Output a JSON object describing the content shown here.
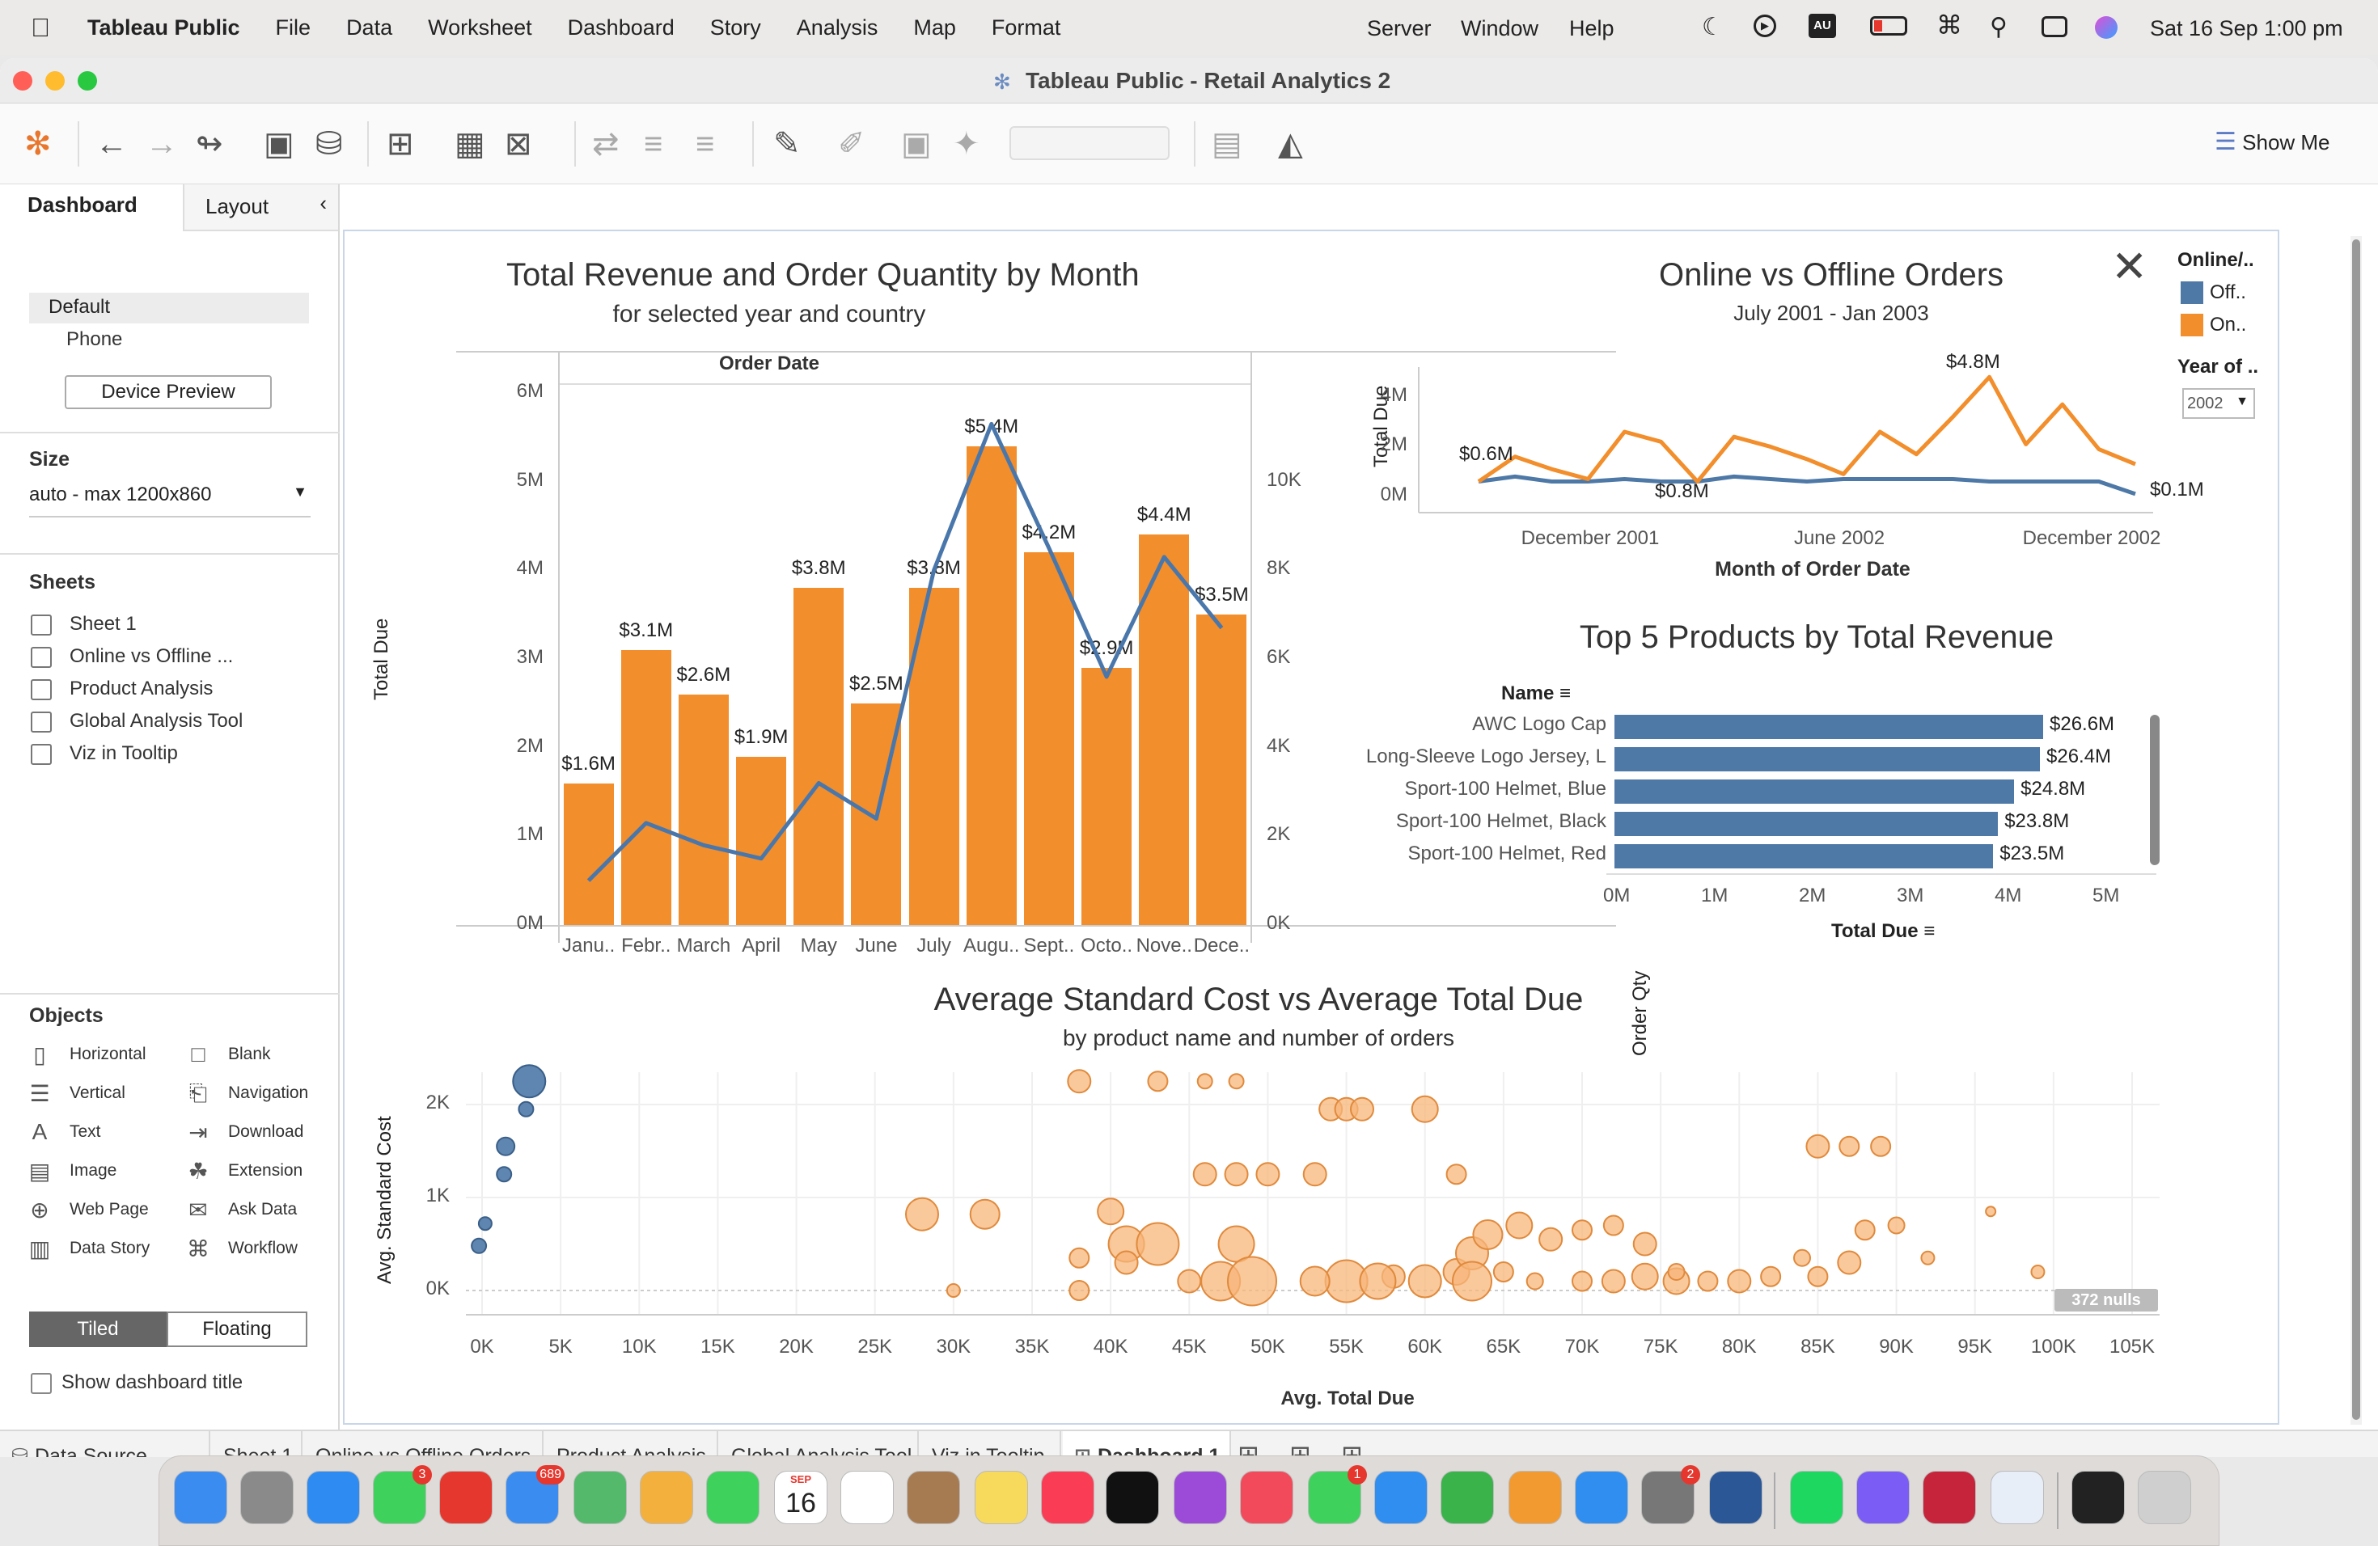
{
  "menubar": {
    "app": "Tableau Public",
    "items": [
      "File",
      "Data",
      "Worksheet",
      "Dashboard",
      "Story",
      "Analysis",
      "Map",
      "Format"
    ],
    "right_items": [
      "Server",
      "Window",
      "Help"
    ],
    "clock": "Sat 16 Sep  1:00 pm"
  },
  "window": {
    "title": "Tableau Public - Retail Analytics 2",
    "show_me": "Show Me"
  },
  "left_panel": {
    "tab_dashboard": "Dashboard",
    "tab_layout": "Layout",
    "devices": [
      "Default",
      "Phone"
    ],
    "device_preview": "Device Preview",
    "size_heading": "Size",
    "size_value": "auto - max 1200x860",
    "sheets_heading": "Sheets",
    "sheets": [
      "Sheet 1",
      "Online vs Offline ...",
      "Product Analysis",
      "Global Analysis Tool",
      "Viz in Tooltip"
    ],
    "objects_heading": "Objects",
    "objects": [
      [
        "Horizontal",
        "Blank"
      ],
      [
        "Vertical",
        "Navigation"
      ],
      [
        "Text",
        "Download"
      ],
      [
        "Image",
        "Extension"
      ],
      [
        "Web Page",
        "Ask Data"
      ],
      [
        "Data Story",
        "Workflow"
      ]
    ],
    "tiled": "Tiled",
    "floating": "Floating",
    "show_title": "Show dashboard title"
  },
  "chart_data": [
    {
      "type": "bar",
      "title": "Total Revenue and Order Quantity by Month",
      "subtitle": "for selected year and country",
      "header": "Order Date",
      "ylabel": "Total Due",
      "y2label": "Order Qty",
      "ylim": [
        0,
        6000000
      ],
      "y2lim": [
        0,
        12000
      ],
      "yticks": [
        "0M",
        "1M",
        "2M",
        "3M",
        "4M",
        "5M",
        "6M"
      ],
      "y2ticks": [
        "0K",
        "2K",
        "4K",
        "6K",
        "8K",
        "10K"
      ],
      "categories": [
        "Janu..",
        "Febr..",
        "March",
        "April",
        "May",
        "June",
        "July",
        "Augu..",
        "Sept..",
        "Octo..",
        "Nove..",
        "Dece.."
      ],
      "values": [
        1.6,
        3.1,
        2.6,
        1.9,
        3.8,
        2.5,
        3.8,
        5.4,
        4.2,
        2.9,
        4.4,
        3.5
      ],
      "labels": [
        "$1.6M",
        "$3.1M",
        "$2.6M",
        "$1.9M",
        "$3.8M",
        "$2.5M",
        "$3.8M",
        "$5.4M",
        "$4.2M",
        "$2.9M",
        "$4.4M",
        "$3.5M"
      ],
      "line_series": {
        "name": "Order Qty",
        "values": [
          1000,
          2300,
          1800,
          1500,
          3200,
          2400,
          8000,
          11300,
          8500,
          5600,
          8300,
          6700
        ]
      }
    },
    {
      "type": "line",
      "title": "Online vs Offline Orders",
      "subtitle": "July 2001 - Jan 2003",
      "xlabel": "Month of Order Date",
      "ylabel": "Total Due",
      "yticks": [
        "0M",
        "2M",
        "4M"
      ],
      "xticks": [
        "December 2001",
        "June 2002",
        "December 2002"
      ],
      "series": [
        {
          "name": "Off..",
          "values": [
            0.6,
            0.8,
            0.6,
            0.6,
            0.7,
            0.6,
            0.6,
            0.8,
            0.7,
            0.6,
            0.7,
            0.7,
            0.7,
            0.7,
            0.6,
            0.6,
            0.6,
            0.6,
            0.1
          ]
        },
        {
          "name": "On..",
          "values": [
            0.6,
            1.6,
            1.1,
            0.7,
            2.6,
            2.2,
            0.6,
            2.4,
            2.0,
            1.5,
            0.9,
            2.6,
            1.7,
            3.2,
            4.8,
            2.1,
            3.7,
            1.9,
            1.3
          ]
        }
      ],
      "data_labels": [
        "$0.6M",
        "$0.8M",
        "$4.8M",
        "$0.1M"
      ],
      "legend": {
        "title": "Online/..",
        "entries": [
          "Off..",
          "On.."
        ]
      },
      "filter": {
        "title": "Year of ..",
        "value": "2002"
      }
    },
    {
      "type": "bar",
      "orientation": "horizontal",
      "title": "Top 5 Products by Total Revenue",
      "header": "Name",
      "xlabel": "Total Due",
      "xticks": [
        "0M",
        "1M",
        "2M",
        "3M",
        "4M",
        "5M"
      ],
      "xlim": [
        0,
        5500000
      ],
      "categories": [
        "AWC Logo Cap",
        "Long-Sleeve Logo Jersey, L",
        "Sport-100 Helmet, Blue",
        "Sport-100 Helmet, Black",
        "Sport-100 Helmet, Red"
      ],
      "values": [
        26.6,
        26.4,
        24.8,
        23.8,
        23.5
      ],
      "labels": [
        "$26.6M",
        "$26.4M",
        "$24.8M",
        "$23.8M",
        "$23.5M"
      ]
    },
    {
      "type": "scatter",
      "title": "Average Standard Cost vs Average Total Due",
      "subtitle": "by product name and number of orders",
      "xlabel": "Avg. Total Due",
      "ylabel": "Avg. Standard Cost",
      "xticks": [
        "0K",
        "5K",
        "10K",
        "15K",
        "20K",
        "25K",
        "30K",
        "35K",
        "40K",
        "45K",
        "50K",
        "55K",
        "60K",
        "65K",
        "70K",
        "75K",
        "80K",
        "85K",
        "90K",
        "95K",
        "100K",
        "105K"
      ],
      "yticks": [
        "0K",
        "1K",
        "2K"
      ],
      "nulls": "372 nulls"
    }
  ],
  "tabs": [
    "Data Source",
    "Sheet 1",
    "Online vs Offline Orders",
    "Product Analysis",
    "Global Analysis Tool",
    "Viz in Tooltip",
    "Dashboard 1"
  ],
  "dock": {
    "calendar_month": "SEP",
    "calendar_day": "16",
    "badges": [
      "3",
      "689",
      "1",
      "2"
    ]
  },
  "colors": {
    "orange": "#f28e2b",
    "blue": "#4e79a7",
    "line": "#4a77ab"
  }
}
